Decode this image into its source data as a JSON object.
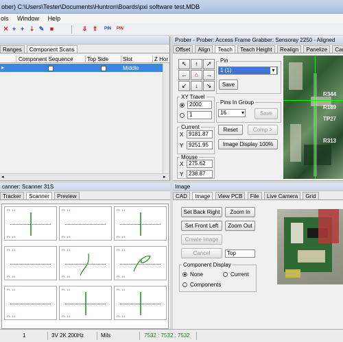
{
  "window": {
    "title": "ober) C:\\Users\\Tester\\Documents\\Huntron\\Boards\\pxi software test.MDB"
  },
  "menu": [
    "ols",
    "Window",
    "Help"
  ],
  "left_panel": {
    "tabs": [
      "Ranges",
      "Component Scans"
    ],
    "columns": [
      "Component Sequence",
      "Top Side",
      "Slot",
      "Z Hor"
    ],
    "row": {
      "component_sequence": "✓",
      "top_side": "✓",
      "slot": "Middle",
      "z_hor": ""
    }
  },
  "prober_panel": {
    "title": "Prober - Prober: Access Frame Grabber: Sensoray 2250 - Aligned",
    "tabs": [
      "Offset",
      "Align",
      "Teach",
      "Teach Height",
      "Realign",
      "Panelize",
      "Camera"
    ],
    "pin": {
      "label": "Pin",
      "value": "1 (1)",
      "save": "Save"
    },
    "xy_travel": {
      "label": "XY Travel",
      "options": [
        "2000",
        "1"
      ]
    },
    "pins_in_group": {
      "label": "Pins In Group",
      "value": "16",
      "save": "Save"
    },
    "reset": "Reset",
    "comp": "Comp >",
    "image_display": "Image Display 100%",
    "current": {
      "label": "Current",
      "x_label": "X",
      "x": "9181.87",
      "y_label": "Y",
      "y": "9251.95"
    },
    "mouse": {
      "label": "Mouse",
      "x_label": "X",
      "x": "275.62",
      "y_label": "Y",
      "y": "238.87"
    },
    "arrows": [
      "↖",
      "↑",
      "↗",
      "←",
      "⌂",
      "→",
      "↙",
      "↓",
      "↘"
    ],
    "camera_labels": [
      "R344",
      "R189",
      "TP27",
      "R313"
    ]
  },
  "scanner_panel": {
    "title": "canner: Scanner 31S",
    "tabs": [
      "Tracker",
      "Scanner",
      "Preview"
    ],
    "cell_label": "P1: 1/1"
  },
  "image_panel": {
    "title": "Image",
    "tabs": [
      "CAD",
      "Image",
      "View PCB",
      "File",
      "Live Camera",
      "Grid"
    ],
    "buttons": {
      "set_back_right": "Set Back Right",
      "zoom_in": "Zoom In",
      "set_front_left": "Set Front Left",
      "zoom_out": "Zoom Out",
      "create_image": "Create Image",
      "cancel": "Cancel"
    },
    "side_value": "Top",
    "component_display": {
      "label": "Component Display",
      "none": "None",
      "current": "Current",
      "components": "Components"
    }
  },
  "status_bar": {
    "field1": "1",
    "field2": "3V 2K 200Hz",
    "field3": "Mils",
    "field4": "7532 : 7532 : 7532"
  }
}
